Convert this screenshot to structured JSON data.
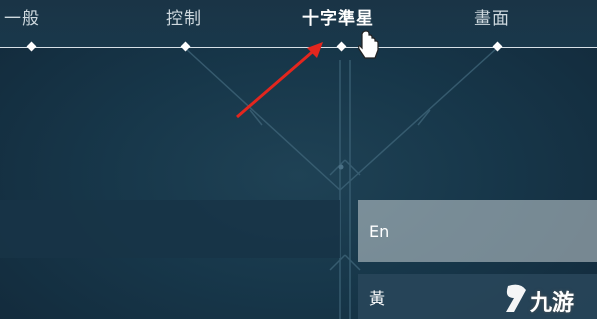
{
  "tabs": [
    {
      "label": "一般",
      "active": false
    },
    {
      "label": "控制",
      "active": false
    },
    {
      "label": "十字準星",
      "active": true
    },
    {
      "label": "畫面",
      "active": false
    }
  ],
  "rows": [
    {
      "label": "En"
    },
    {
      "label": "黃"
    }
  ],
  "watermark": {
    "text": "九游",
    "icon": "9game-logo-icon"
  },
  "colors": {
    "accent": "#e3261e",
    "background": "#173345",
    "line": "#d6e0e6"
  }
}
